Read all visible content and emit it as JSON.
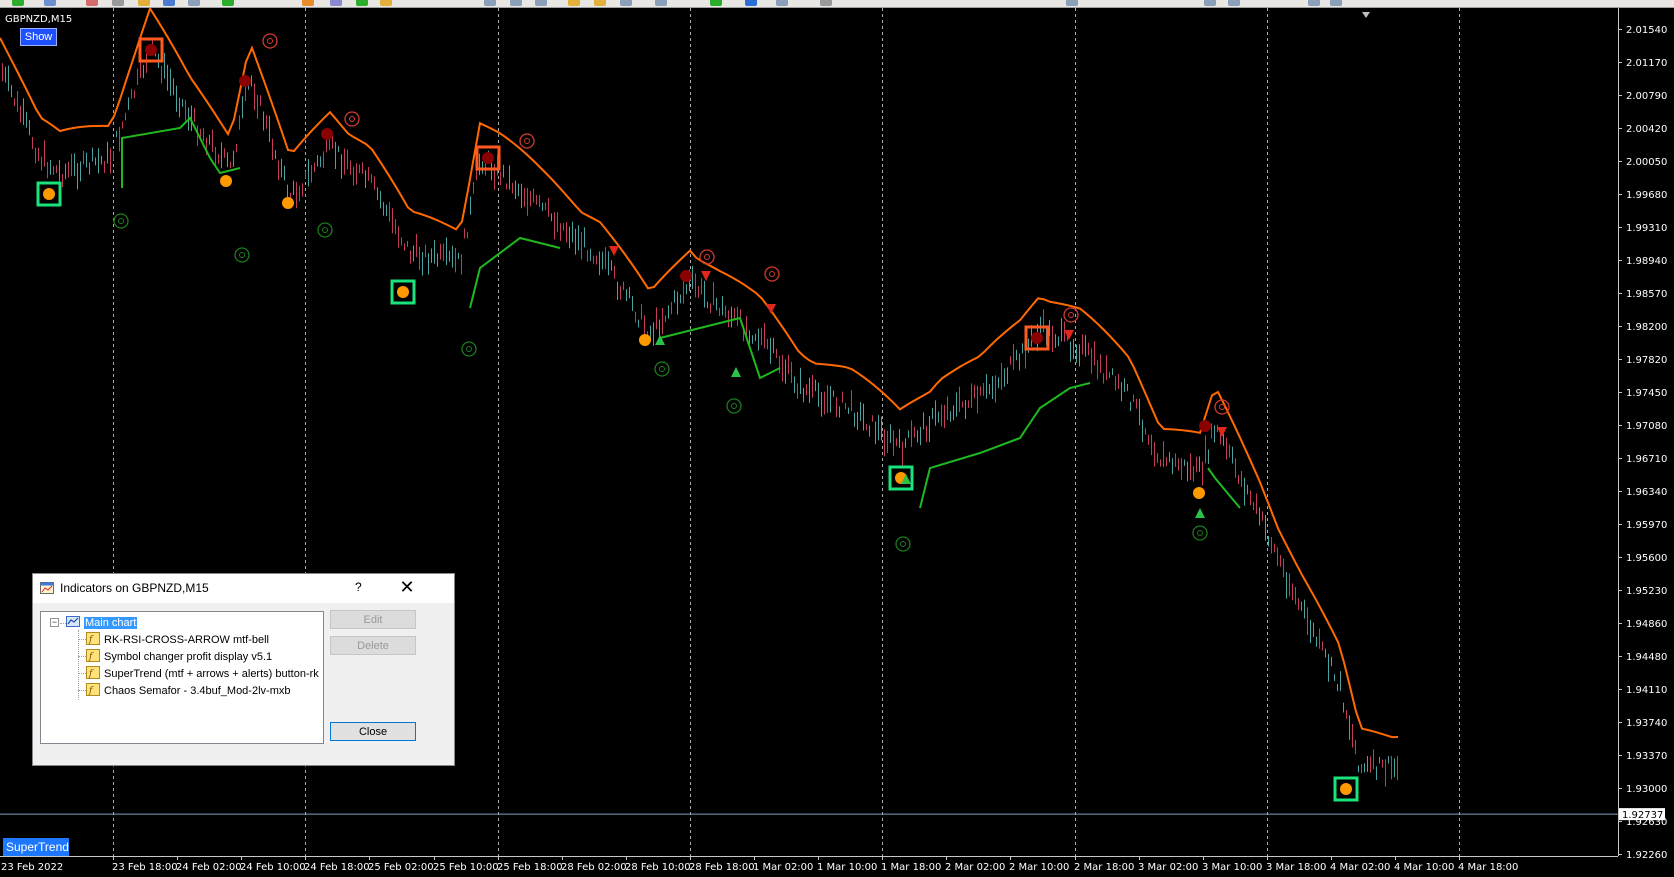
{
  "chart": {
    "symbol_label": "GBPNZD,M15",
    "show_button": "Show",
    "supertrend_button": "SuperTrend",
    "current_price": "1.92737",
    "price_levels": [
      "2.01540",
      "2.01170",
      "2.00790",
      "2.00420",
      "2.00050",
      "1.99680",
      "1.99310",
      "1.98940",
      "1.98570",
      "1.98200",
      "1.97820",
      "1.97450",
      "1.97080",
      "1.96710",
      "1.96340",
      "1.95970",
      "1.95600",
      "1.95230",
      "1.94860",
      "1.94480",
      "1.94110",
      "1.93740",
      "1.93370",
      "1.93000",
      "1.92630",
      "1.92260"
    ],
    "time_labels": [
      "23 Feb 2022",
      "23 Feb 18:00",
      "24 Feb 02:00",
      "24 Feb 10:00",
      "24 Feb 18:00",
      "25 Feb 02:00",
      "25 Feb 10:00",
      "25 Feb 18:00",
      "28 Feb 02:00",
      "28 Feb 10:00",
      "28 Feb 18:00",
      "1 Mar 02:00",
      "1 Mar 10:00",
      "1 Mar 18:00",
      "2 Mar 02:00",
      "2 Mar 10:00",
      "2 Mar 18:00",
      "3 Mar 02:00",
      "3 Mar 10:00",
      "3 Mar 18:00",
      "4 Mar 02:00",
      "4 Mar 10:00",
      "4 Mar 18:00"
    ],
    "colors": {
      "background": "#000000",
      "supertrend_down": "#ff6a00",
      "supertrend_up": "#1fb81f",
      "candles_bull": "#4aa3a3",
      "candles_bear": "#c23b5a",
      "semafor_high_box": "#ff5a1f",
      "semafor_low_box": "#19e37a",
      "semafor_dot": "#ff9900",
      "current_price_line": "#7fa3c8",
      "grid_separator": "#c8c8c8",
      "axis_text": "#ffffff"
    }
  },
  "dialog": {
    "title": "Indicators on GBPNZD,M15",
    "help": "?",
    "close_glyph": "✕",
    "tree": {
      "root": "Main chart",
      "expander": "−",
      "items": [
        "RK-RSI-CROSS-ARROW mtf-bell",
        "Symbol changer profit display v5.1",
        "SuperTrend (mtf + arrows + alerts) button-rk",
        "Chaos Semafor - 3.4buf_Mod-2lv-mxb"
      ]
    },
    "buttons": {
      "edit": "Edit",
      "delete": "Delete",
      "close": "Close"
    }
  }
}
